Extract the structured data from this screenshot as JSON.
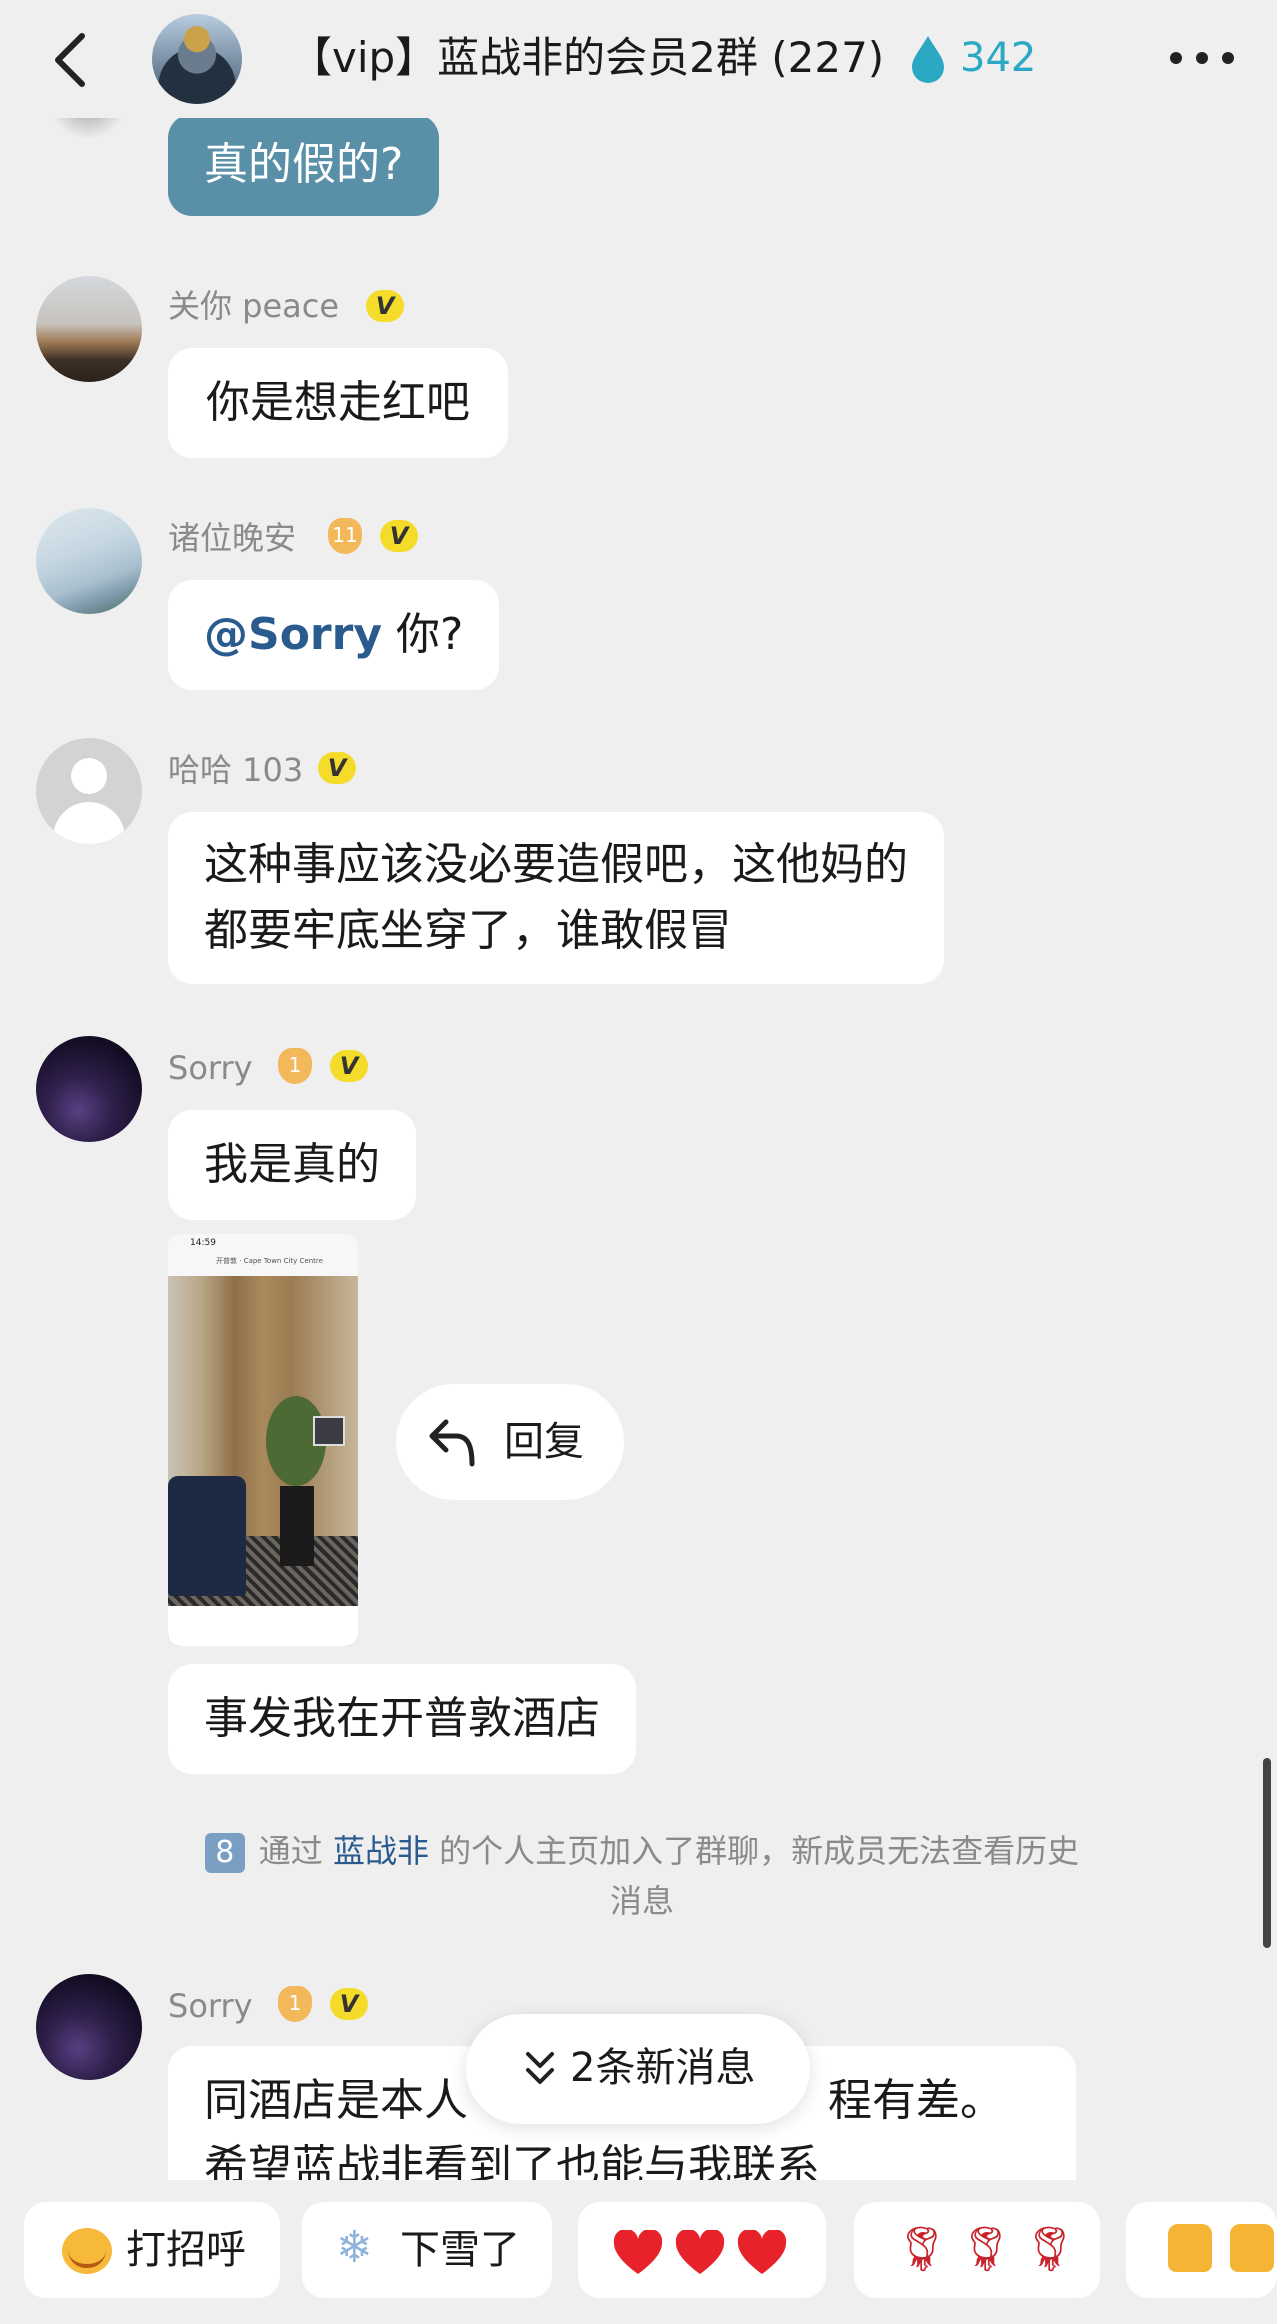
{
  "header": {
    "title": "【vip】蓝战非的会员2群 (227)",
    "heat_value": "342",
    "accent_color": "#2aa8c4"
  },
  "messages": {
    "self_top": {
      "text": "真的假的?"
    },
    "m1": {
      "user": "关你 peace",
      "badge_v": "V",
      "text": "你是想走红吧"
    },
    "m2": {
      "user": "诸位晚安",
      "level": "11",
      "badge_v": "V",
      "mention": "@Sorry",
      "text": " 你?"
    },
    "m3": {
      "user": "哈哈 103",
      "badge_v": "V",
      "line1": "这种事应该没必要造假吧，这他妈的",
      "line2": "都要牢底坐穿了，谁敢假冒"
    },
    "m4": {
      "user": "Sorry",
      "level": "1",
      "badge_v": "V",
      "text": "我是真的",
      "text2": "事发我在开普敦酒店"
    },
    "m5": {
      "user": "Sorry",
      "level": "1",
      "badge_v": "V",
      "line1": "同酒店是本人",
      "line1b": "程有差。",
      "line2": "希望蓝战非看到了也能与我联系"
    }
  },
  "image_card": {
    "status_time": "14:59",
    "caption": "开普敦 · Cape Town City Centre"
  },
  "reply_popup": {
    "label": "回复"
  },
  "system_message": {
    "num": "8",
    "prefix": "通过 ",
    "link": "蓝战非",
    "suffix": " 的个人主页加入了群聊，新成员无法查看历史",
    "line2": "消息"
  },
  "new_messages_pill": {
    "label": "2条新消息"
  },
  "quick_replies": [
    {
      "icon": "smile-icon",
      "label": "打招呼"
    },
    {
      "icon": "snowflake-icon",
      "label": "下雪了"
    },
    {
      "icon": "hearts-icon",
      "label": ""
    },
    {
      "icon": "roses-icon",
      "label": ""
    },
    {
      "icon": "thumbs-up-icon",
      "label": ""
    }
  ]
}
